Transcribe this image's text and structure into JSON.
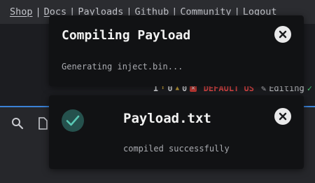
{
  "topbar": {
    "nav": [
      {
        "label": "Shop"
      },
      {
        "label": "Docs"
      },
      {
        "label": "Payloads"
      },
      {
        "label": "Github"
      },
      {
        "label": "Community"
      },
      {
        "label": "Logout"
      }
    ],
    "separator": "|"
  },
  "statusbar": {
    "line_count": "1",
    "warning_count": "0",
    "error_count": "0",
    "keyboard_layout": "DEFAULT US",
    "mode": "Editing",
    "icons": {
      "warning": "warning-icon",
      "error": "error-icon",
      "edit": "pencil-icon",
      "status": "checkmark-icon"
    }
  },
  "editor": {
    "tools": [
      {
        "icon": "search-icon"
      },
      {
        "icon": "file-icon"
      }
    ]
  },
  "toasts": {
    "compiling": {
      "title": "Compiling Payload",
      "message": "Generating inject.bin...",
      "close_icon": "close-icon"
    },
    "done": {
      "title": "Payload.txt",
      "message": "compiled successfully",
      "badge_icon": "checkmark-circle-icon",
      "close_icon": "close-icon"
    }
  },
  "colors": {
    "accent_blue": "#3b82d6",
    "success_teal": "#25514d",
    "success_check": "#59c8b4",
    "layout_red": "#e04848",
    "status_green": "#3fbf6a"
  }
}
